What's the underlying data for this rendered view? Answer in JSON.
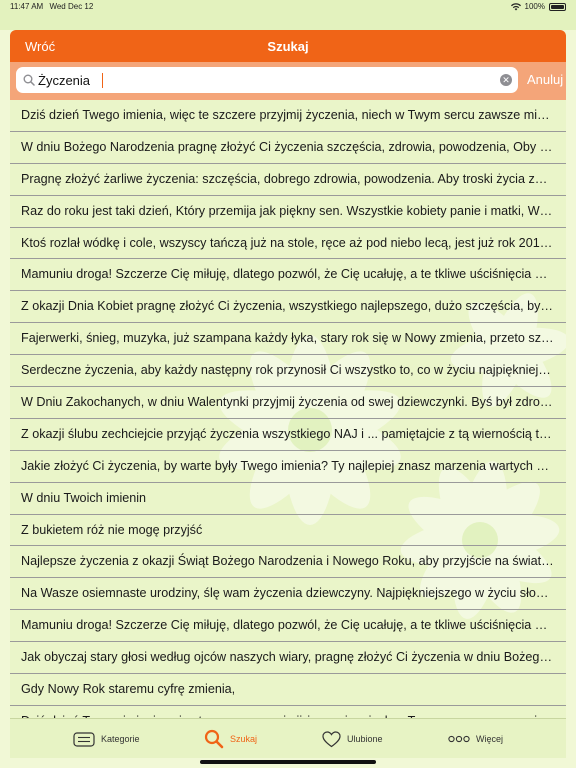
{
  "status_bar": {
    "time": "11:47 AM",
    "date": "Wed Dec 12",
    "battery": "100%"
  },
  "nav": {
    "back_label": "Wróć",
    "title": "Szukaj"
  },
  "search": {
    "value": "Życzenia",
    "cancel_label": "Anuluj"
  },
  "results": [
    "Dziś dzień Twego imienia, więc te szczere przyjmij życzenia, niech w Twym sercu zawsze mieszka radość",
    "W dniu Bożego Narodzenia pragnę złożyć Ci życzenia szczęścia, zdrowia, powodzenia, Oby troski poszły w las",
    "Pragnę złożyć żarliwe życzenia: szczęścia, dobrego zdrowia, powodzenia. Aby troski życia zaginęły",
    "Raz do roku jest taki dzień, Który przemija jak piękny sen. Wszystkie kobiety panie i matki, W dniu kobiet",
    "Ktoś rozlał wódkę i cole, wszyscy tańczą już na stole, ręce aż pod niebo lecą, jest już rok 2015. Szczęśliwego",
    "Mamuniu droga! Szczerze Cię miłuję, dlatego pozwól, że Cię ucałuję, a te tkliwe uściśnięcia niech wyrażą",
    "Z okazji Dnia Kobiet pragnę złożyć Ci życzenia, wszystkiego najlepszego, dużo szczęścia, by wszystkie marzenia",
    "Fajerwerki, śnieg, muzyka, już szampana każdy łyka, stary rok się w Nowy zmienia, przeto szczere życzenia",
    "Serdeczne życzenia, aby każdy następny rok przynosił Ci wszystko to, co w życiu najpiękniejsze.",
    "W Dniu Zakochanych, w dniu Walentynki przyjmij życzenia od swej dziewczynki. Byś był zdrowy",
    "Z okazji ślubu zechciejcie przyjąć życzenia wszystkiego NAJ i ... pamiętajcie z tą wiernością to nie żarty",
    "Jakie złożyć Ci życzenia, by warte były Twego imienia? Ty najlepiej znasz marzenia wartych spełnienia",
    "W dniu Twoich imienin",
    "Z bukietem róż nie mogę przyjść",
    "Najlepsze życzenia z okazji Świąt Bożego Narodzenia i Nowego Roku, aby przyjście na świat Chrystusa",
    "Na Wasze osiemnaste urodziny, ślę wam życzenia dziewczyny. Najpiękniejszego w życiu słonko niech świeci",
    "Mamuniu droga! Szczerze Cię miłuję, dlatego pozwól, że Cię ucałuję, a te tkliwe uściśnięcia niech wyrażą",
    "Jak obyczaj stary głosi według ojców naszych wiary, pragnę złożyć Ci życzenia w dniu Bożego Narodzenia",
    "Gdy Nowy Rok staremu cyfrę zmienia,",
    "Dziś dzień Twego imienia, więc te szczere przyjmij życzenia, niech w Twym sercu zawsze mieszka radość"
  ],
  "tabs": [
    {
      "label": "Kategorie",
      "icon": "list-icon"
    },
    {
      "label": "Szukaj",
      "icon": "search-icon"
    },
    {
      "label": "Ulubione",
      "icon": "heart-icon"
    },
    {
      "label": "Więcej",
      "icon": "more-icon"
    }
  ],
  "colors": {
    "accent": "#f06417",
    "background": "#eaf5c9"
  }
}
